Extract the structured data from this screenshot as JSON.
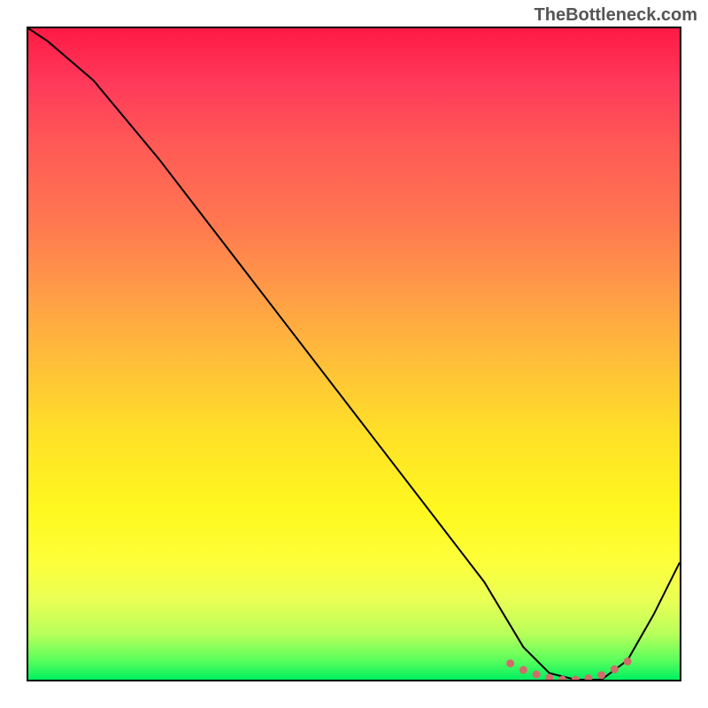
{
  "watermark": "TheBottleneck.com",
  "chart_data": {
    "type": "line",
    "title": "",
    "xlabel": "",
    "ylabel": "",
    "xlim": [
      0,
      100
    ],
    "ylim": [
      0,
      100
    ],
    "series": [
      {
        "name": "black-curve",
        "x": [
          0,
          3,
          10,
          20,
          30,
          40,
          50,
          60,
          70,
          76,
          80,
          84,
          88,
          92,
          96,
          100
        ],
        "values": [
          100,
          98,
          92,
          80,
          67,
          54,
          41,
          28,
          15,
          5,
          1,
          0,
          0,
          3,
          10,
          18
        ],
        "color": "#000000",
        "style": "line",
        "width": 2
      },
      {
        "name": "highlight-dots",
        "x": [
          74,
          76,
          78,
          80,
          82,
          84,
          86,
          88,
          90,
          92
        ],
        "values": [
          2.5,
          1.5,
          0.8,
          0.3,
          0,
          0,
          0.2,
          0.7,
          1.6,
          2.8
        ],
        "color": "#d26b6b",
        "style": "dots",
        "radius": 4.5
      }
    ],
    "gradient_stops": [
      {
        "pos": 0,
        "color": "#ff1a44"
      },
      {
        "pos": 8,
        "color": "#ff385a"
      },
      {
        "pos": 18,
        "color": "#ff5a56"
      },
      {
        "pos": 30,
        "color": "#ff7850"
      },
      {
        "pos": 40,
        "color": "#ff9a48"
      },
      {
        "pos": 50,
        "color": "#ffbb3b"
      },
      {
        "pos": 62,
        "color": "#ffe028"
      },
      {
        "pos": 74,
        "color": "#fff81f"
      },
      {
        "pos": 82,
        "color": "#fdff3a"
      },
      {
        "pos": 88,
        "color": "#e8ff55"
      },
      {
        "pos": 93,
        "color": "#b8ff5a"
      },
      {
        "pos": 97,
        "color": "#5bff5c"
      },
      {
        "pos": 100,
        "color": "#00f060"
      }
    ]
  }
}
